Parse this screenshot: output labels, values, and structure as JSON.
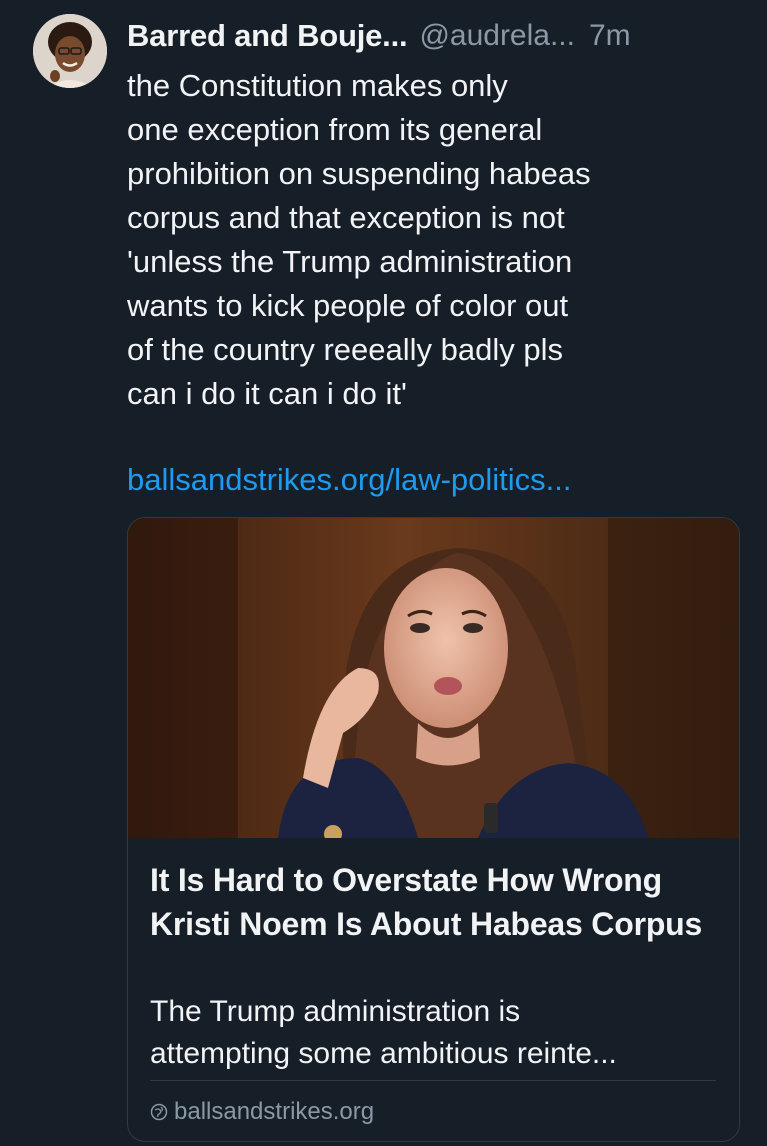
{
  "author": {
    "display_name": "Barred and Bouje...",
    "handle": "@audrela...",
    "time": "7m"
  },
  "post": {
    "text": "the Constitution makes only\none exception from its general\nprohibition on suspending habeas\ncorpus and that exception is not\n'unless the Trump administration\nwants to kick people of color out\nof the country reeeally badly pls\ncan i do it can i do it'",
    "link_text": "ballsandstrikes.org/law-politics..."
  },
  "card": {
    "title": "It Is Hard to Overstate How Wrong Kristi Noem Is About Habeas Corpus",
    "description": "The Trump administration is\nattempting some ambitious reinte...",
    "source": "ballsandstrikes.org"
  },
  "colors": {
    "background": "#161e27",
    "text": "#f1f3f5",
    "muted": "#8b98a5",
    "link": "#1d9bf0",
    "border": "#2f3a45"
  },
  "icons": {
    "source": "globe-icon"
  }
}
